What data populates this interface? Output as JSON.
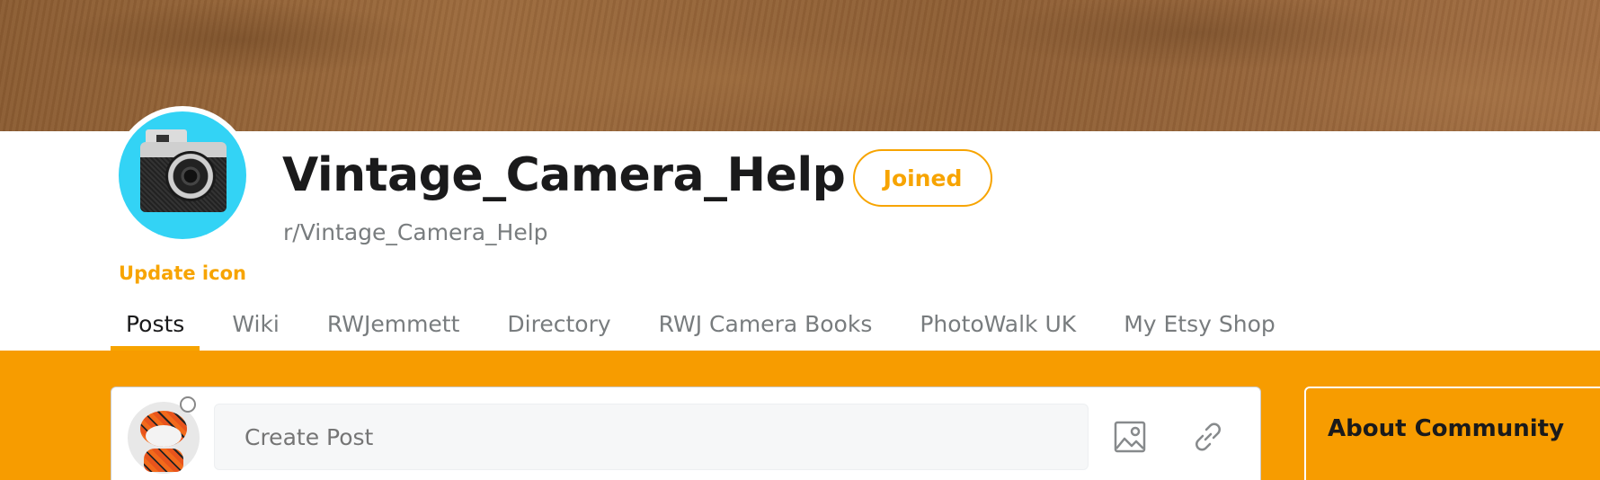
{
  "community": {
    "name": "Vintage_Camera_Help",
    "slug": "r/Vintage_Camera_Help",
    "update_icon_label": "Update icon",
    "joined_label": "Joined"
  },
  "tabs": [
    {
      "label": "Posts",
      "active": true
    },
    {
      "label": "Wiki"
    },
    {
      "label": "RWJemmett"
    },
    {
      "label": "Directory"
    },
    {
      "label": "RWJ Camera Books"
    },
    {
      "label": "PhotoWalk UK"
    },
    {
      "label": "My Etsy Shop"
    }
  ],
  "create_post": {
    "placeholder": "Create Post",
    "icons": [
      "image-icon",
      "link-icon"
    ]
  },
  "sidebar": {
    "about_title": "About Community"
  },
  "colors": {
    "accent": "#f7a400",
    "band": "#f79c00",
    "avatar_bg": "#33d3f5"
  }
}
